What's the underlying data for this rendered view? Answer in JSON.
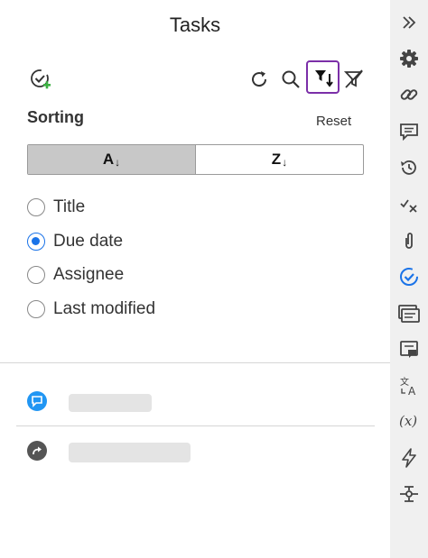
{
  "header": {
    "title": "Tasks"
  },
  "toolbar": {
    "add_task_icon": "check-circle-plus-icon",
    "refresh_icon": "refresh-icon",
    "search_icon": "search-icon",
    "sort_filter_icon": "sort-filter-icon",
    "clear_filter_icon": "filter-off-icon",
    "active_color": "#7b2fa8"
  },
  "sorting": {
    "label": "Sorting",
    "reset_label": "Reset",
    "direction": [
      {
        "letter": "A",
        "arrow": "↓",
        "active": true
      },
      {
        "letter": "Z",
        "arrow": "↓",
        "active": false
      }
    ],
    "options": [
      {
        "label": "Title",
        "checked": false
      },
      {
        "label": "Due date",
        "checked": true
      },
      {
        "label": "Assignee",
        "checked": false
      },
      {
        "label": "Last modified",
        "checked": false
      }
    ]
  },
  "list": {
    "items": [
      {
        "icon": "comment-icon",
        "icon_color": "#2196f3"
      },
      {
        "icon": "share-arrow-icon",
        "icon_color": "#555555"
      }
    ]
  },
  "rail": {
    "icons": [
      "collapse-chevrons-icon",
      "gear-icon",
      "link-icon",
      "comment-icon",
      "history-icon",
      "check-x-icon",
      "paperclip-icon",
      "tasks-check-icon",
      "cards-icon",
      "comment-box-icon",
      "translate-icon",
      "variable-icon",
      "lightning-icon",
      "merge-icon"
    ],
    "active_color": "#1a73e8"
  }
}
